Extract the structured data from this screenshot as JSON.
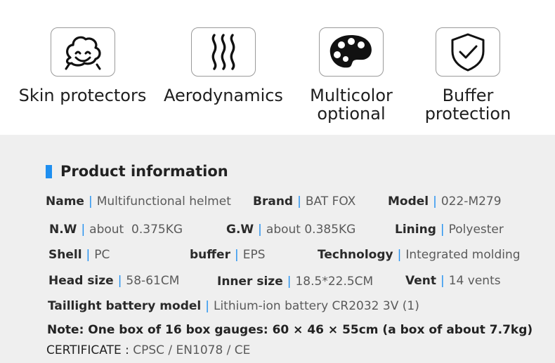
{
  "features": [
    {
      "label": "Skin protectors",
      "icon": "smiley-icon"
    },
    {
      "label": "Aerodynamics",
      "icon": "wind-waves-icon"
    },
    {
      "label": "Multicolor\noptional",
      "icon": "palette-icon"
    },
    {
      "label": "Buffer\nprotection",
      "icon": "shield-check-icon"
    }
  ],
  "product_info": {
    "title": "Product information",
    "accent_color": "#1f8ff0",
    "specs": [
      {
        "key": "Name",
        "value": "Multifunctional helmet"
      },
      {
        "key": "Brand",
        "value": "BAT FOX"
      },
      {
        "key": "Model",
        "value": "022-M279"
      },
      {
        "key": "N.W",
        "value": "about  0.375KG"
      },
      {
        "key": "G.W",
        "value": "about 0.385KG"
      },
      {
        "key": "Lining",
        "value": "Polyester"
      },
      {
        "key": "Shell",
        "value": "PC"
      },
      {
        "key": "buffer",
        "value": "EPS"
      },
      {
        "key": "Technology",
        "value": "Integrated molding"
      },
      {
        "key": "Head size",
        "value": "58-61CM"
      },
      {
        "key": "Inner size",
        "value": "18.5*22.5CM"
      },
      {
        "key": "Vent",
        "value": "14 vents"
      },
      {
        "key": "Taillight battery model",
        "value": "Lithium-ion battery CR2032 3V (1)"
      }
    ],
    "separator": "|",
    "note": "Note: One box of 16 box gauges: 60 × 46 × 55cm (a box of about 7.7kg)",
    "certificate_label": "CERTIFICATE :",
    "certificate_value": "CPSC / EN1078 / CE"
  }
}
